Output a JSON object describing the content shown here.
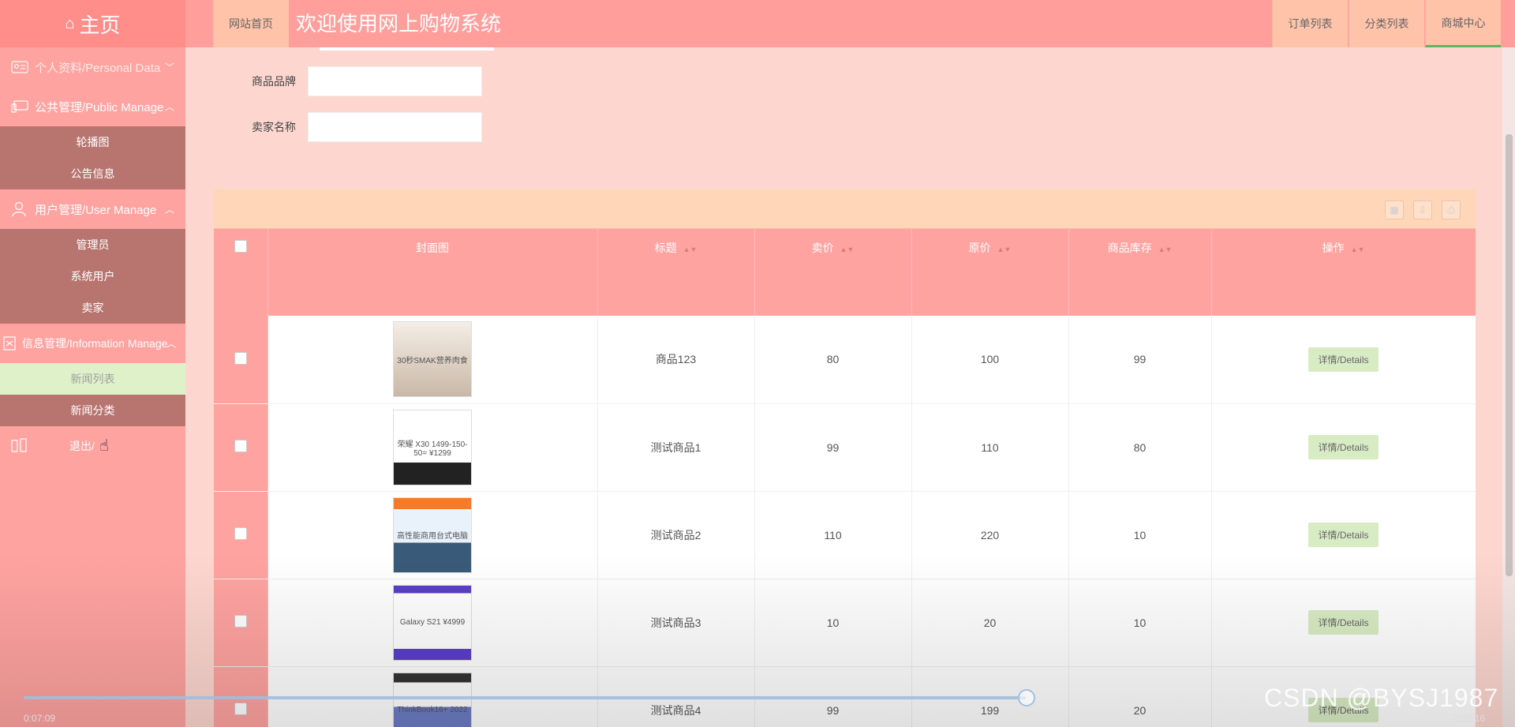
{
  "sidebar": {
    "home": "主页",
    "personal": "个人资料/Personal Data",
    "public_manage": "公共管理/Public Manage",
    "public_items": [
      "轮播图",
      "公告信息"
    ],
    "user_manage": "用户管理/User Manage",
    "user_items": [
      "管理员",
      "系统用户",
      "卖家"
    ],
    "info_manage": "信息管理/Information Manage",
    "info_items": [
      "新闻列表",
      "新闻分类"
    ],
    "logout": "退出/"
  },
  "header": {
    "home_link": "网站首页",
    "title": "欢迎使用网上购物系统",
    "nav": [
      "订单列表",
      "分类列表",
      "商城中心"
    ]
  },
  "form": {
    "brand_label": "商品品牌",
    "brand_value": "",
    "seller_label": "卖家名称",
    "seller_value": ""
  },
  "table": {
    "columns": [
      "封面图",
      "标题",
      "卖价",
      "原价",
      "商品库存",
      "操作"
    ],
    "rows": [
      {
        "title": "商品123",
        "price": "80",
        "original": "100",
        "stock": "99",
        "action": "详情/Details",
        "cover_text": "30秒SMAK营养肉食"
      },
      {
        "title": "测试商品1",
        "price": "99",
        "original": "110",
        "stock": "80",
        "action": "详情/Details",
        "cover_text": "荣耀 X30 1499-150-50= ¥1299"
      },
      {
        "title": "测试商品2",
        "price": "110",
        "original": "220",
        "stock": "10",
        "action": "详情/Details",
        "cover_text": "高性能商用台式电脑"
      },
      {
        "title": "测试商品3",
        "price": "10",
        "original": "20",
        "stock": "10",
        "action": "详情/Details",
        "cover_text": "Galaxy S21 ¥4999"
      },
      {
        "title": "测试商品4",
        "price": "99",
        "original": "199",
        "stock": "20",
        "action": "详情/Details",
        "cover_text": "ThinkBook16+ 2022"
      }
    ]
  },
  "video": {
    "current_time": "0:07:09",
    "total_time": "0:08:16",
    "progress": 0.842
  },
  "watermark": "CSDN @BYSJ1987",
  "colors": {
    "sidebar_bg": "#ffa3a0",
    "header_bg": "#ff9e9b",
    "page_bg": "#fdd6cf",
    "submenu_bg": "#b87570",
    "active_item": "#dff1c9",
    "detail_button": "#d8ecc4"
  }
}
